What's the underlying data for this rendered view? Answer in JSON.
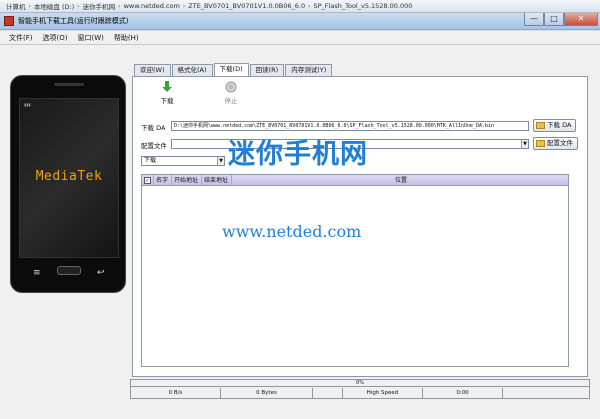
{
  "explorer": {
    "crumbs": [
      "计算机",
      "本地磁盘 (D:)",
      "迷你手机网",
      "www.netded.com",
      "ZTE_BV0701_BV0701V1.0.0B06_6.0",
      "SP_Flash_Tool_v5.1528.00.000"
    ]
  },
  "window": {
    "title": "智能手机下载工具(运行时跟踪模式)",
    "min": "—",
    "max": "□",
    "close": "✕"
  },
  "menu": [
    "文件(F)",
    "选项(O)",
    "窗口(W)",
    "帮助(H)"
  ],
  "phone": {
    "brand": "MediaTek",
    "back": "↩"
  },
  "tabs": [
    "欢迎(W)",
    "格式化(A)",
    "下载(D)",
    "回读(R)",
    "内存测试(Y)"
  ],
  "toolbar": {
    "download": "下载",
    "stop": "停止"
  },
  "form": {
    "da_label": "下载 DA",
    "da_value": "D:\\迷你手机网\\www.netded.com\\ZTE_BV0701_BV0701V1.0.0B06_6.0\\SP_Flash_Tool_v5.1528.00.000\\MTK_AllInOne_DA.bin",
    "da_button": "下载 DA",
    "scatter_label": "配置文件",
    "scatter_value": "",
    "scatter_button": "配置文件",
    "mode": "下载"
  },
  "table": {
    "headers": [
      "名字",
      "开始地址",
      "结束地址",
      "位置"
    ]
  },
  "status": {
    "percent": "0%",
    "rate": "0 B/s",
    "bytes": "0 Bytes",
    "speed": "High Speed",
    "time": "0:00"
  },
  "watermark": {
    "name": "迷你手机网",
    "url": "www.netded.com"
  },
  "colors": {
    "watermark": "#1f7fd6",
    "header": "#c6c0e8",
    "brand": "#f0a020"
  }
}
